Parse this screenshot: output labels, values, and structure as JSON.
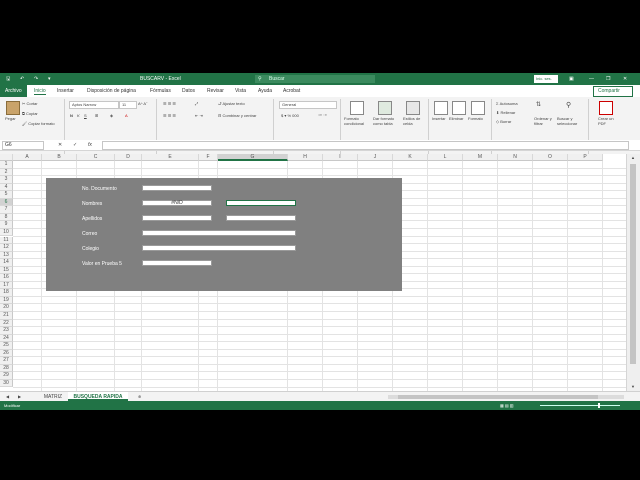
{
  "window": {
    "title": "BUSCARV  -  Excel",
    "search_placeholder": "Buscar",
    "account": "Inic. ses.",
    "minimize": "—",
    "restore": "❐",
    "close": "✕"
  },
  "tabs": [
    "Archivo",
    "Inicio",
    "Insertar",
    "Disposición de página",
    "Fórmulas",
    "Datos",
    "Revisar",
    "Vista",
    "Ayuda",
    "Acrobat"
  ],
  "share": "Compartir",
  "ribbon": {
    "paste": "Pegar",
    "cut": "Cortar",
    "copy": "Copiar",
    "format_painter": "Copiar formato",
    "font_name": "Aptos Narrow",
    "font_size": "11",
    "wrap": "Ajustar texto",
    "merge": "Combinar y centrar",
    "number_format": "General",
    "cond_format": "Formato condicional",
    "table_format": "Dar formato como tabla",
    "cell_styles": "Estilos de celda",
    "insert": "Insertar",
    "delete": "Eliminar",
    "format": "Formato",
    "autosum": "Autosuma",
    "fill": "Rellenar",
    "clear": "Borrar",
    "sort": "Ordenar y filtrar",
    "find": "Buscar y seleccionar",
    "create_pdf": "Crear un PDF",
    "groups": [
      "Portapapeles",
      "Fuente",
      "Alineación",
      "Número",
      "Estilos",
      "Celdas",
      "Edición",
      "Adobe Acrobat"
    ]
  },
  "formula_bar": {
    "name_box": "G6",
    "fx": "fx"
  },
  "columns": [
    "A",
    "B",
    "C",
    "D",
    "E",
    "F",
    "G",
    "H",
    "I",
    "J",
    "K",
    "L",
    "M",
    "N",
    "O",
    "P"
  ],
  "rows": [
    "1",
    "2",
    "3",
    "4",
    "5",
    "6",
    "7",
    "8",
    "9",
    "10",
    "11",
    "12",
    "13",
    "14",
    "15",
    "16",
    "17",
    "18",
    "19",
    "20",
    "21",
    "22",
    "23",
    "24",
    "25",
    "26",
    "27",
    "28",
    "29",
    "30"
  ],
  "form": {
    "fields": [
      {
        "label": "No. Documento",
        "value": ""
      },
      {
        "label": "Nombres",
        "value": "#N/D"
      },
      {
        "label": "Apellidos",
        "value": ""
      },
      {
        "label": "Correo",
        "value": ""
      },
      {
        "label": "Colegio",
        "value": ""
      },
      {
        "label": "Valor en Prueba 5",
        "value": ""
      }
    ]
  },
  "sheets": [
    "MATRIZ",
    "BUSQUEDA RAPIDA"
  ],
  "status": "Modificar",
  "colors": {
    "accent": "#217346",
    "panel": "#808080"
  }
}
